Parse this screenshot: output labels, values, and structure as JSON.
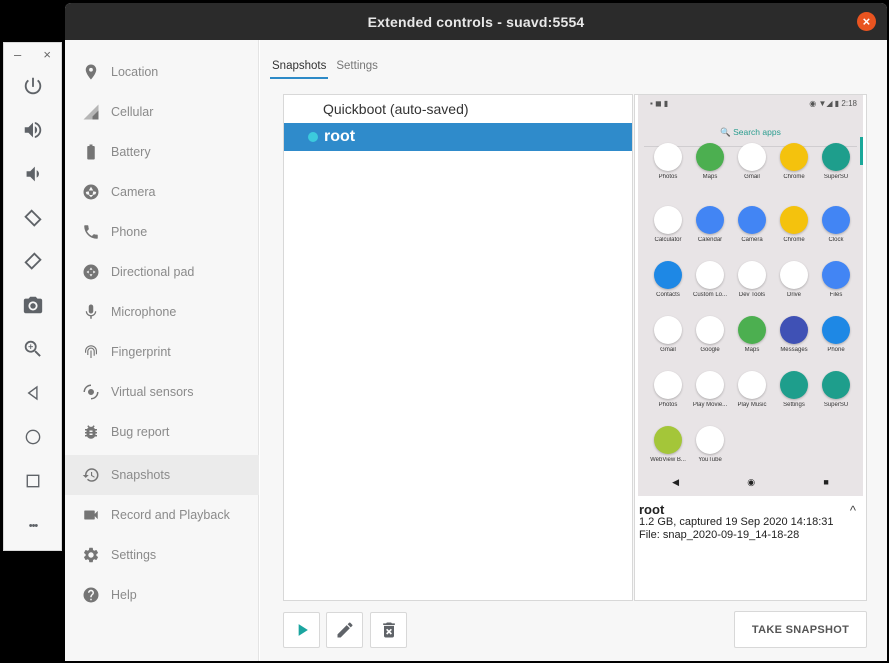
{
  "window": {
    "title": "Extended controls - suavd:5554",
    "close_glyph": "×"
  },
  "emulator_toolbar": {
    "minimize_glyph": "–",
    "close_glyph": "×",
    "buttons": [
      "power-icon",
      "volume-up-icon",
      "volume-down-icon",
      "rotate-left-icon",
      "rotate-right-icon",
      "camera-icon",
      "zoom-icon",
      "back-icon",
      "home-icon",
      "overview-icon",
      "more-icon"
    ],
    "more_glyph": "•••"
  },
  "sidebar": {
    "items": [
      {
        "label": "Location",
        "icon": "location-pin-icon"
      },
      {
        "label": "Cellular",
        "icon": "cellular-signal-icon"
      },
      {
        "label": "Battery",
        "icon": "battery-icon"
      },
      {
        "label": "Camera",
        "icon": "camera-aperture-icon"
      },
      {
        "label": "Phone",
        "icon": "phone-icon"
      },
      {
        "label": "Directional pad",
        "icon": "dpad-icon"
      },
      {
        "label": "Microphone",
        "icon": "microphone-icon"
      },
      {
        "label": "Fingerprint",
        "icon": "fingerprint-icon"
      },
      {
        "label": "Virtual sensors",
        "icon": "sensors-icon"
      },
      {
        "label": "Bug report",
        "icon": "bug-icon"
      },
      {
        "label": "Snapshots",
        "icon": "history-icon",
        "active": true
      },
      {
        "label": "Record and Playback",
        "icon": "video-camera-icon"
      },
      {
        "label": "Settings",
        "icon": "gear-icon"
      },
      {
        "label": "Help",
        "icon": "help-icon"
      }
    ]
  },
  "tabs": [
    {
      "label": "Snapshots",
      "active": true
    },
    {
      "label": "Settings"
    }
  ],
  "snapshots": [
    {
      "label": "Quickboot (auto-saved)",
      "selected": false
    },
    {
      "label": "root",
      "selected": true
    }
  ],
  "preview": {
    "status_left": "▪ ◼ ▮",
    "status_time": "2:18",
    "status_icons": "◉ ▼◢ ▮",
    "search_label": "🔍 Search apps",
    "apps": [
      {
        "name": "Photos",
        "color": "#ffffff"
      },
      {
        "name": "Maps",
        "color": "#4caf50"
      },
      {
        "name": "Gmail",
        "color": "#ffffff"
      },
      {
        "name": "Chrome",
        "color": "#f4c20d"
      },
      {
        "name": "SuperSU",
        "color": "#1e9e8c"
      },
      {
        "name": "Calculator",
        "color": "#ffffff"
      },
      {
        "name": "Calendar",
        "color": "#4285f4"
      },
      {
        "name": "Camera",
        "color": "#4285f4"
      },
      {
        "name": "Chrome",
        "color": "#f4c20d"
      },
      {
        "name": "Clock",
        "color": "#4285f4"
      },
      {
        "name": "Contacts",
        "color": "#1e88e5"
      },
      {
        "name": "Custom Lo...",
        "color": "#ffffff"
      },
      {
        "name": "Dev Tools",
        "color": "#ffffff"
      },
      {
        "name": "Drive",
        "color": "#ffffff"
      },
      {
        "name": "Files",
        "color": "#4285f4"
      },
      {
        "name": "Gmail",
        "color": "#ffffff"
      },
      {
        "name": "Google",
        "color": "#ffffff"
      },
      {
        "name": "Maps",
        "color": "#4caf50"
      },
      {
        "name": "Messages",
        "color": "#3f51b5"
      },
      {
        "name": "Phone",
        "color": "#1e88e5"
      },
      {
        "name": "Photos",
        "color": "#ffffff"
      },
      {
        "name": "Play Movie...",
        "color": "#ffffff"
      },
      {
        "name": "Play Music",
        "color": "#ffffff"
      },
      {
        "name": "Settings",
        "color": "#1e9e8c"
      },
      {
        "name": "SuperSU",
        "color": "#1e9e8c"
      },
      {
        "name": "WebView B...",
        "color": "#a4c639"
      },
      {
        "name": "YouTube",
        "color": "#ffffff"
      }
    ],
    "nav_back": "◀",
    "nav_home": "◉",
    "nav_recent": "■"
  },
  "snapshot_info": {
    "name": "root",
    "details": "1.2 GB, captured 19 Sep 2020 14:18:31",
    "file": "File: snap_2020-09-19_14-18-28",
    "chevron": "^"
  },
  "actions": {
    "take_snapshot": "TAKE SNAPSHOT",
    "play_icon": "play-icon",
    "edit_icon": "edit-icon",
    "delete_icon": "delete-icon"
  }
}
